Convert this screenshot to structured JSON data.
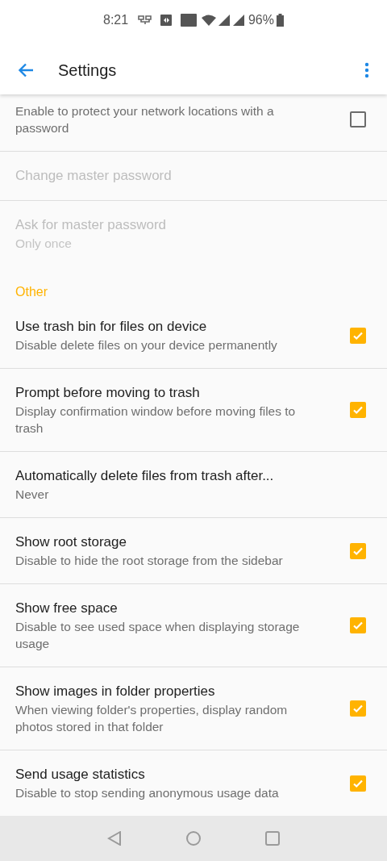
{
  "status_bar": {
    "time": "8:21",
    "battery": "96%"
  },
  "app_bar": {
    "title": "Settings"
  },
  "items": [
    {
      "kind": "checkbox",
      "subtitle": "Enable to protect your network locations with a password",
      "checked": false,
      "disabled": false
    },
    {
      "kind": "plain",
      "title": "Change master password",
      "disabled": true
    },
    {
      "kind": "plain",
      "title": "Ask for master password",
      "subtitle": "Only once",
      "disabled": true,
      "divider": false
    },
    {
      "kind": "header",
      "title": "Other"
    },
    {
      "kind": "checkbox",
      "title": "Use trash bin for files on device",
      "subtitle": "Disable delete files on your device permanently",
      "checked": true,
      "disabled": false
    },
    {
      "kind": "checkbox",
      "title": "Prompt before moving to trash",
      "subtitle": "Display confirmation window before moving files to trash",
      "checked": true,
      "disabled": false
    },
    {
      "kind": "plain",
      "title": "Automatically delete files from trash after...",
      "subtitle": "Never",
      "disabled": false
    },
    {
      "kind": "checkbox",
      "title": "Show root storage",
      "subtitle": "Disable to hide the root storage from the sidebar",
      "checked": true,
      "disabled": false
    },
    {
      "kind": "checkbox",
      "title": "Show free space",
      "subtitle": "Disable to see used space when displaying storage usage",
      "checked": true,
      "disabled": false
    },
    {
      "kind": "checkbox",
      "title": "Show images in folder properties",
      "subtitle": "When viewing folder's properties, display random photos stored in that folder",
      "checked": true,
      "disabled": false
    },
    {
      "kind": "checkbox",
      "title": "Send usage statistics",
      "subtitle": "Disable to stop sending anonymous usage data",
      "checked": true,
      "disabled": false,
      "divider": false
    }
  ]
}
